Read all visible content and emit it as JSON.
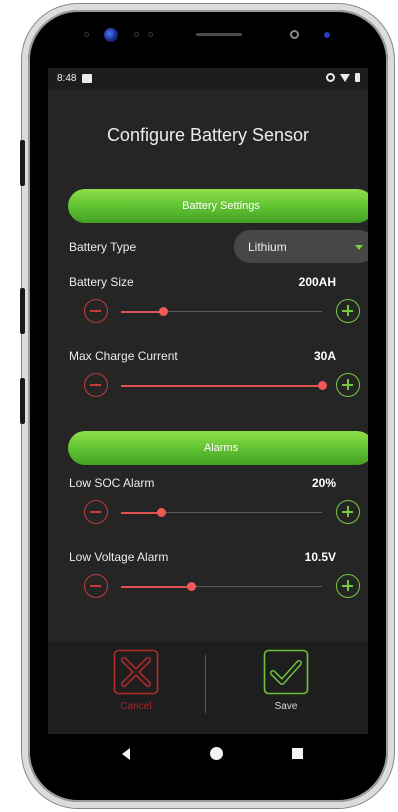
{
  "status_bar": {
    "time": "8:48"
  },
  "title": "Configure Battery Sensor",
  "battery_settings": {
    "header": "Battery Settings",
    "battery_type": {
      "label": "Battery Type",
      "selected": "Lithium"
    },
    "battery_size": {
      "label": "Battery Size",
      "value": "200AH",
      "slider_fraction": 0.21
    },
    "max_charge_current": {
      "label": "Max Charge Current",
      "value": "30A",
      "slider_fraction": 1.0
    }
  },
  "alarms": {
    "header": "Alarms",
    "low_soc": {
      "label": "Low SOC Alarm",
      "value": "20%",
      "slider_fraction": 0.2
    },
    "low_voltage": {
      "label": "Low Voltage Alarm",
      "value": "10.5V",
      "slider_fraction": 0.35
    }
  },
  "actions": {
    "cancel_label": "Cancel",
    "save_label": "Save"
  },
  "colors": {
    "accent_green": "#5ec031",
    "slider_red": "#e05252",
    "cancel_red": "#a52626",
    "background": "#252525"
  },
  "icons": {
    "minus": "minus-circle-icon",
    "plus": "plus-circle-icon",
    "cancel": "x-square-icon",
    "save": "check-square-icon"
  }
}
